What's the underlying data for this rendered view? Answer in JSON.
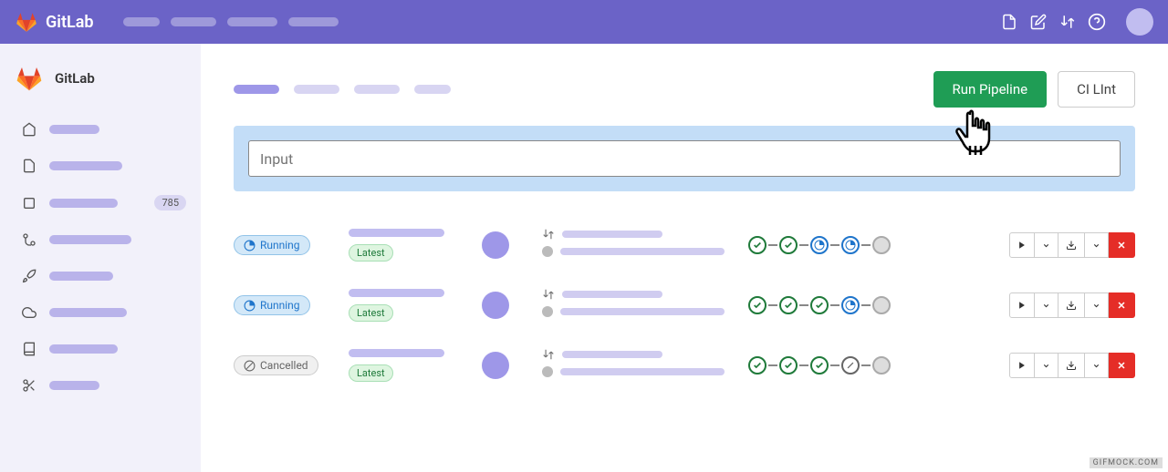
{
  "topbar": {
    "brand": "GitLab"
  },
  "sidebar": {
    "project_name": "GitLab",
    "badge_count": "785"
  },
  "content": {
    "run_pipeline_label": "Run Pipeline",
    "ci_lint_label": "CI LInt",
    "input_placeholder": "Input"
  },
  "pipelines": [
    {
      "status": "Running",
      "status_type": "running",
      "latest_label": "Latest",
      "stages": [
        "success",
        "success",
        "running",
        "running",
        "pending"
      ]
    },
    {
      "status": "Running",
      "status_type": "running",
      "latest_label": "Latest",
      "stages": [
        "success",
        "success",
        "success",
        "running",
        "pending"
      ]
    },
    {
      "status": "Cancelled",
      "status_type": "cancelled",
      "latest_label": "Latest",
      "stages": [
        "success",
        "success",
        "success",
        "cancelled",
        "pending"
      ]
    }
  ],
  "watermark": "GIFMOCK.COM"
}
